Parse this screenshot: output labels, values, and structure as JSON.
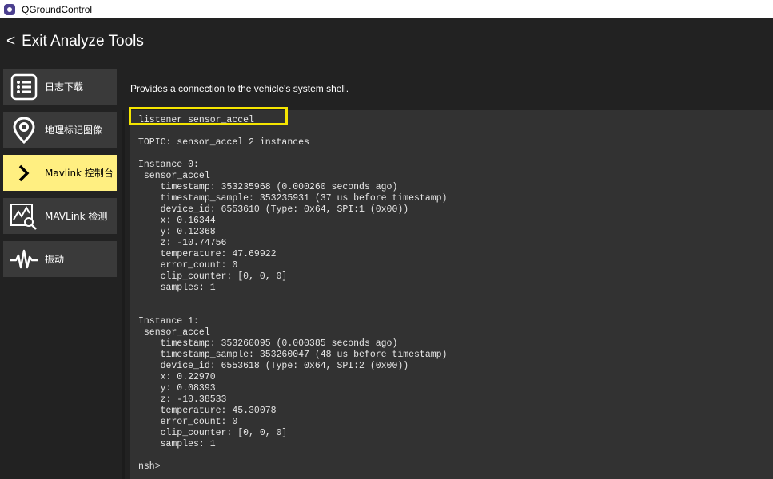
{
  "app": {
    "title": "QGroundControl",
    "icon": "qgc-logo-icon"
  },
  "header": {
    "exit_label": "Exit Analyze Tools",
    "back_glyph": "<"
  },
  "sidebar": {
    "items": [
      {
        "label": "日志下载",
        "icon": "list-icon",
        "active": false
      },
      {
        "label": "地理标记图像",
        "icon": "map-pin-icon",
        "active": false
      },
      {
        "label": "Mavlink 控制台",
        "icon": "chevron-right-icon",
        "active": true
      },
      {
        "label": "MAVLink 检测",
        "icon": "chart-search-icon",
        "active": false
      },
      {
        "label": "振动",
        "icon": "waveform-icon",
        "active": false
      }
    ]
  },
  "main": {
    "description": "Provides a connection to the vehicle's system shell.",
    "command": "listener sensor_accel",
    "output": "TOPIC: sensor_accel 2 instances\n\nInstance 0:\n sensor_accel\n    timestamp: 353235968 (0.000260 seconds ago)\n    timestamp_sample: 353235931 (37 us before timestamp)\n    device_id: 6553610 (Type: 0x64, SPI:1 (0x00))\n    x: 0.16344\n    y: 0.12368\n    z: -10.74756\n    temperature: 47.69922\n    error_count: 0\n    clip_counter: [0, 0, 0]\n    samples: 1\n\n\nInstance 1:\n sensor_accel\n    timestamp: 353260095 (0.000385 seconds ago)\n    timestamp_sample: 353260047 (48 us before timestamp)\n    device_id: 6553618 (Type: 0x64, SPI:2 (0x00))\n    x: 0.22970\n    y: 0.08393\n    z: -10.38533\n    temperature: 45.30078\n    error_count: 0\n    clip_counter: [0, 0, 0]\n    samples: 1\n\nnsh>"
  },
  "colors": {
    "background": "#222222",
    "nav_item": "#3a3a3a",
    "nav_active": "#ffef81",
    "console_bg": "#323232",
    "highlight": "#f5e500"
  }
}
